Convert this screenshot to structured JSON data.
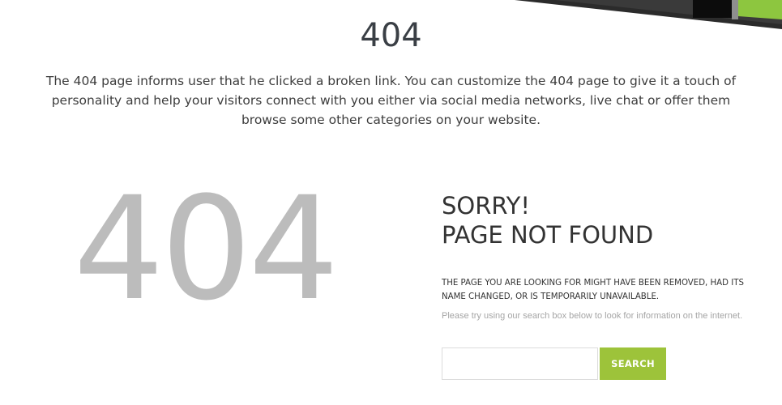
{
  "header": {
    "title": "404",
    "intro": "The 404 page informs user that he clicked a broken link. You can customize the 404 page to give it a touch of personality and help your visitors connect with you either via social media networks, live chat or offer them browse some other categories on your website."
  },
  "error_block": {
    "code": "404",
    "sorry_line1": "SORRY!",
    "sorry_line2": "PAGE NOT FOUND",
    "explanation": "THE PAGE YOU ARE LOOKING FOR MIGHT HAVE BEEN REMOVED, HAD ITS NAME CHANGED, OR IS TEMPORARILY UNAVAILABLE.",
    "hint": "Please try using our search box below to look for information on the internet."
  },
  "search": {
    "value": "",
    "placeholder": "",
    "button_label": "SEARCH"
  },
  "colors": {
    "accent": "#9dc33a",
    "big_code": "#bcbcbc",
    "text": "#3d3d3d",
    "hint": "#a5a5a5"
  }
}
